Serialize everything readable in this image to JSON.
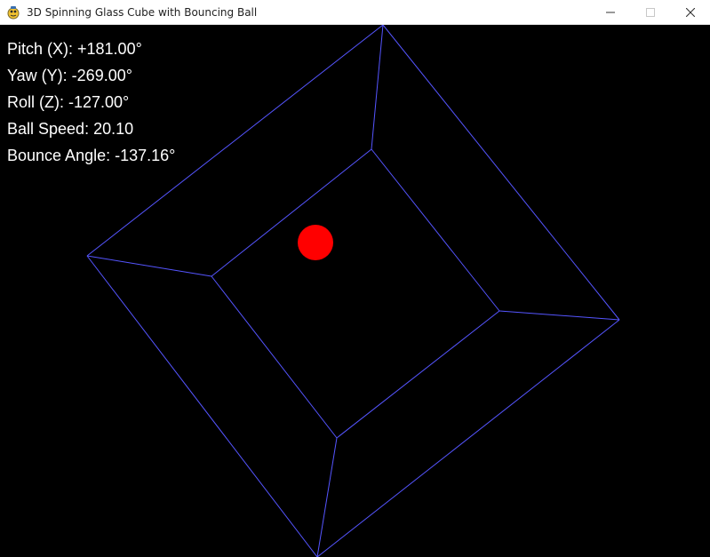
{
  "window": {
    "title": "3D Spinning Glass Cube with Bouncing Ball",
    "icon": "pygame-snake-icon",
    "controls": [
      "minimize-icon",
      "maximize-icon",
      "close-icon"
    ]
  },
  "scene": {
    "background": "#000000",
    "edge_color": "#5555ff",
    "ball_color": "#ff0000"
  },
  "hud": {
    "pitch": "Pitch (X): +181.00°",
    "yaw": "Yaw (Y): -269.00°",
    "roll": "Roll (Z): -127.00°",
    "ball_speed": "Ball Speed: 20.10",
    "bounce_angle": "Bounce Angle: -137.16°"
  }
}
